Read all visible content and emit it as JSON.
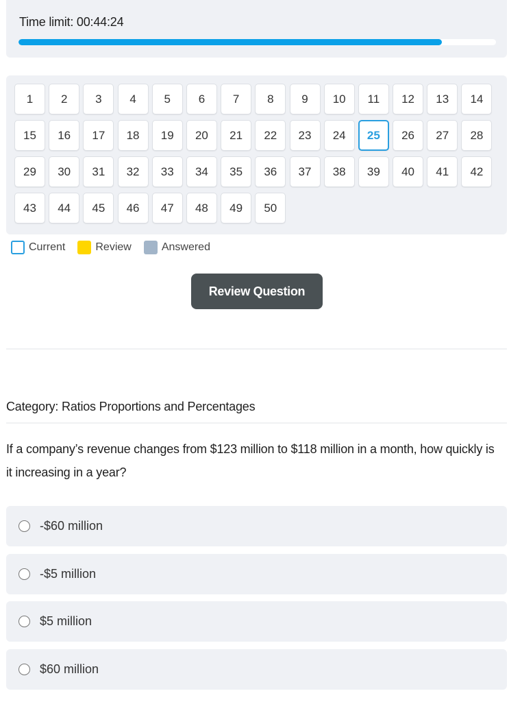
{
  "timer": {
    "label": "Time limit: 00:44:24",
    "progress_fraction": 0.887,
    "progress_color": "#0aa0e8"
  },
  "question_grid": {
    "current": 25,
    "numbers": [
      1,
      2,
      3,
      4,
      5,
      6,
      7,
      8,
      9,
      10,
      11,
      12,
      13,
      14,
      15,
      16,
      17,
      18,
      19,
      20,
      21,
      22,
      23,
      24,
      25,
      26,
      27,
      28,
      29,
      30,
      31,
      32,
      33,
      34,
      35,
      36,
      37,
      38,
      39,
      40,
      41,
      42,
      43,
      44,
      45,
      46,
      47,
      48,
      49,
      50
    ]
  },
  "legend": {
    "current": "Current",
    "review": "Review",
    "answered": "Answered",
    "colors": {
      "current": "#2a9fe0",
      "review": "#ffd600",
      "answered": "#a2b5c9"
    }
  },
  "review_button": {
    "label": "Review Question"
  },
  "category": "Category: Ratios Proportions and Percentages",
  "question": "If a company’s revenue changes from $123 million to $118 million in a month, how quickly is it increasing in a year?",
  "options": [
    {
      "label": "-$60 million",
      "selected": false
    },
    {
      "label": "-$5 million",
      "selected": false
    },
    {
      "label": "$5 million",
      "selected": false
    },
    {
      "label": "$60 million",
      "selected": false
    }
  ]
}
